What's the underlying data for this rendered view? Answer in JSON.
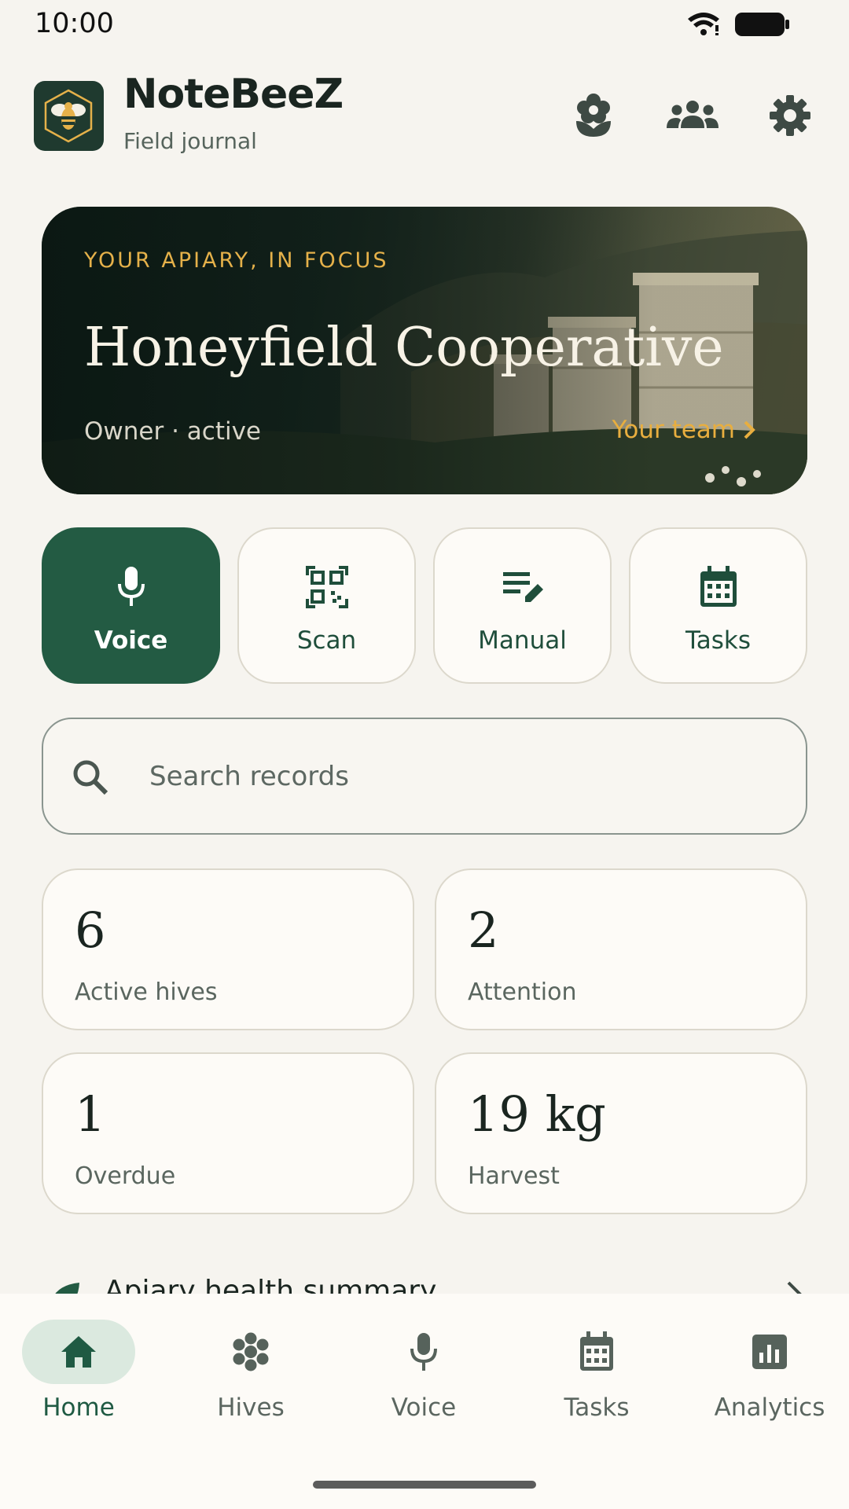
{
  "status_bar": {
    "time": "10:00"
  },
  "header": {
    "title": "NoteBeeZ",
    "subtitle": "Field journal",
    "actions": [
      "flower-icon",
      "team-icon",
      "settings-icon"
    ]
  },
  "hero": {
    "eyebrow": "YOUR APIARY, IN FOCUS",
    "title": "Honeyfield Cooperative",
    "role": "Owner · active",
    "team_link": "Your team"
  },
  "quick_actions": [
    {
      "label": "Voice",
      "icon": "microphone-icon"
    },
    {
      "label": "Scan",
      "icon": "qr-code-icon"
    },
    {
      "label": "Manual",
      "icon": "edit-note-icon"
    },
    {
      "label": "Tasks",
      "icon": "calendar-icon"
    }
  ],
  "search": {
    "placeholder": "Search records",
    "value": ""
  },
  "stats": [
    {
      "value": "6",
      "label": "Active hives"
    },
    {
      "value": "2",
      "label": "Attention"
    },
    {
      "value": "1",
      "label": "Overdue"
    },
    {
      "value": "19 kg",
      "label": "Harvest"
    }
  ],
  "health_summary": {
    "label": "Apiary health summary"
  },
  "bottom_nav": {
    "items": [
      {
        "label": "Home",
        "icon": "home-icon",
        "active": true
      },
      {
        "label": "Hives",
        "icon": "hive-icon",
        "active": false
      },
      {
        "label": "Voice",
        "icon": "microphone-icon",
        "active": false
      },
      {
        "label": "Tasks",
        "icon": "calendar-icon",
        "active": false
      },
      {
        "label": "Analytics",
        "icon": "analytics-icon",
        "active": false
      }
    ]
  },
  "colors": {
    "background": "#f6f4ef",
    "primary": "#235b43",
    "accent_gold": "#e5b14a",
    "card": "#fdfbf7",
    "nav_active_pill": "#dbe9df"
  }
}
